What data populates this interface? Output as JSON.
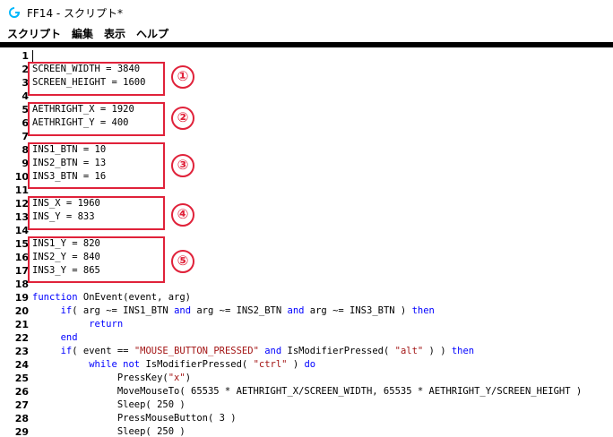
{
  "window": {
    "title": "FF14 - スクリプト*",
    "app_icon": "logitech-g-icon"
  },
  "colors": {
    "keyword": "#0000ff",
    "string": "#a31515",
    "annotation": "#e0223a"
  },
  "menu": {
    "items": [
      "スクリプト",
      "編集",
      "表示",
      "ヘルプ"
    ]
  },
  "annotations": [
    "①",
    "②",
    "③",
    "④",
    "⑤"
  ],
  "editor": {
    "lines": [
      [],
      [
        [
          "SCREEN_WIDTH = 3840",
          "plain"
        ]
      ],
      [
        [
          "SCREEN_HEIGHT = 1600",
          "plain"
        ]
      ],
      [],
      [
        [
          "AETHRIGHT_X = 1920",
          "plain"
        ]
      ],
      [
        [
          "AETHRIGHT_Y = 400",
          "plain"
        ]
      ],
      [],
      [
        [
          "INS1_BTN = 10",
          "plain"
        ]
      ],
      [
        [
          "INS2_BTN = 13",
          "plain"
        ]
      ],
      [
        [
          "INS3_BTN = 16",
          "plain"
        ]
      ],
      [],
      [
        [
          "INS_X = 1960",
          "plain"
        ]
      ],
      [
        [
          "INS_Y = 833",
          "plain"
        ]
      ],
      [],
      [
        [
          "INS1_Y = 820",
          "plain"
        ]
      ],
      [
        [
          "INS2_Y = 840",
          "plain"
        ]
      ],
      [
        [
          "INS3_Y = 865",
          "plain"
        ]
      ],
      [],
      [
        [
          "function",
          "kw"
        ],
        [
          " OnEvent(event, arg)",
          "plain"
        ]
      ],
      [
        [
          "     if",
          "kw"
        ],
        [
          "( arg ~= INS1_BTN ",
          "plain"
        ],
        [
          "and",
          "kw"
        ],
        [
          " arg ~= INS2_BTN ",
          "plain"
        ],
        [
          "and",
          "kw"
        ],
        [
          " arg ~= INS3_BTN ) ",
          "plain"
        ],
        [
          "then",
          "kw"
        ]
      ],
      [
        [
          "          return",
          "kw"
        ]
      ],
      [
        [
          "     end",
          "kw"
        ]
      ],
      [
        [
          "     if",
          "kw"
        ],
        [
          "( event == ",
          "plain"
        ],
        [
          "\"MOUSE_BUTTON_PRESSED\"",
          "str"
        ],
        [
          " ",
          "plain"
        ],
        [
          "and",
          "kw"
        ],
        [
          " IsModifierPressed( ",
          "plain"
        ],
        [
          "\"alt\"",
          "str"
        ],
        [
          " ) ) ",
          "plain"
        ],
        [
          "then",
          "kw"
        ]
      ],
      [
        [
          "          while",
          "kw"
        ],
        [
          " ",
          "plain"
        ],
        [
          "not",
          "kw"
        ],
        [
          " IsModifierPressed( ",
          "plain"
        ],
        [
          "\"ctrl\"",
          "str"
        ],
        [
          " ) ",
          "plain"
        ],
        [
          "do",
          "kw"
        ]
      ],
      [
        [
          "               PressKey(",
          "plain"
        ],
        [
          "\"x\"",
          "str"
        ],
        [
          ")",
          "plain"
        ]
      ],
      [
        [
          "               MoveMouseTo( 65535 * AETHRIGHT_X/SCREEN_WIDTH, 65535 * AETHRIGHT_Y/SCREEN_HEIGHT )",
          "plain"
        ]
      ],
      [
        [
          "               Sleep( 250 )",
          "plain"
        ]
      ],
      [
        [
          "               PressMouseButton( 3 )",
          "plain"
        ]
      ],
      [
        [
          "               Sleep( 250 )",
          "plain"
        ]
      ]
    ]
  }
}
